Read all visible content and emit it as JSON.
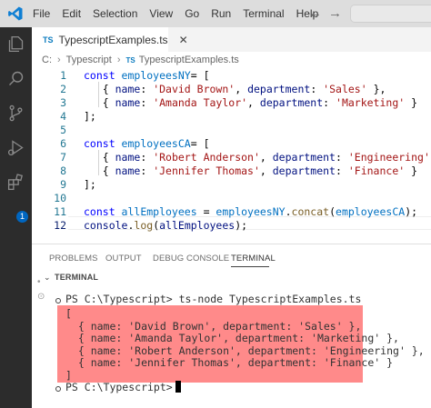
{
  "menu": [
    "File",
    "Edit",
    "Selection",
    "View",
    "Go",
    "Run",
    "Terminal",
    "Help"
  ],
  "editor": {
    "tab_badge": "TS",
    "tab_label": "TypescriptExamples.ts",
    "breadcrumb": [
      "C:",
      "Typescript",
      "TypescriptExamples.ts"
    ],
    "active_line": 12,
    "lines": [
      {
        "n": "1",
        "tokens": [
          [
            "k",
            "const "
          ],
          [
            "c",
            "employeesNY"
          ],
          [
            "",
            "= ["
          ]
        ]
      },
      {
        "n": "2",
        "tokens": [
          [
            "",
            "   { "
          ],
          [
            "v",
            "name"
          ],
          [
            "",
            ": "
          ],
          [
            "s",
            "'David Brown'"
          ],
          [
            "",
            ", "
          ],
          [
            "v",
            "department"
          ],
          [
            "",
            ": "
          ],
          [
            "s",
            "'Sales'"
          ],
          [
            "",
            " },"
          ]
        ]
      },
      {
        "n": "3",
        "tokens": [
          [
            "",
            "   { "
          ],
          [
            "v",
            "name"
          ],
          [
            "",
            ": "
          ],
          [
            "s",
            "'Amanda Taylor'"
          ],
          [
            "",
            ", "
          ],
          [
            "v",
            "department"
          ],
          [
            "",
            ": "
          ],
          [
            "s",
            "'Marketing'"
          ],
          [
            "",
            " }"
          ]
        ]
      },
      {
        "n": "4",
        "tokens": [
          [
            "",
            "];"
          ]
        ]
      },
      {
        "n": "5",
        "tokens": []
      },
      {
        "n": "6",
        "tokens": [
          [
            "k",
            "const "
          ],
          [
            "c",
            "employeesCA"
          ],
          [
            "",
            "= ["
          ]
        ]
      },
      {
        "n": "7",
        "tokens": [
          [
            "",
            "   { "
          ],
          [
            "v",
            "name"
          ],
          [
            "",
            ": "
          ],
          [
            "s",
            "'Robert Anderson'"
          ],
          [
            "",
            ", "
          ],
          [
            "v",
            "department"
          ],
          [
            "",
            ": "
          ],
          [
            "s",
            "'Engineering'"
          ],
          [
            "",
            " },"
          ]
        ]
      },
      {
        "n": "8",
        "tokens": [
          [
            "",
            "   { "
          ],
          [
            "v",
            "name"
          ],
          [
            "",
            ": "
          ],
          [
            "s",
            "'Jennifer Thomas'"
          ],
          [
            "",
            ", "
          ],
          [
            "v",
            "department"
          ],
          [
            "",
            ": "
          ],
          [
            "s",
            "'Finance'"
          ],
          [
            "",
            " }"
          ]
        ]
      },
      {
        "n": "9",
        "tokens": [
          [
            "",
            "];"
          ]
        ]
      },
      {
        "n": "10",
        "tokens": []
      },
      {
        "n": "11",
        "tokens": [
          [
            "k",
            "const "
          ],
          [
            "c",
            "allEmployees"
          ],
          [
            "",
            " = "
          ],
          [
            "c",
            "employeesNY"
          ],
          [
            "",
            "."
          ],
          [
            "f",
            "concat"
          ],
          [
            "",
            "("
          ],
          [
            "c",
            "employeesCA"
          ],
          [
            "",
            ");"
          ]
        ]
      },
      {
        "n": "12",
        "tokens": [
          [
            "v",
            "console"
          ],
          [
            "",
            "."
          ],
          [
            "f",
            "log"
          ],
          [
            "",
            "("
          ],
          [
            "v",
            "allEmployees"
          ],
          [
            "",
            ");"
          ]
        ]
      }
    ]
  },
  "panel": {
    "tabs": [
      "PROBLEMS",
      "OUTPUT",
      "DEBUG CONSOLE",
      "TERMINAL"
    ],
    "active_tab": "TERMINAL",
    "section_title": "TERMINAL",
    "command_line": "PS C:\\Typescript> ts-node TypescriptExamples.ts",
    "output": [
      "[",
      "  { name: 'David Brown', department: 'Sales' },",
      "  { name: 'Amanda Taylor', department: 'Marketing' },",
      "  { name: 'Robert Anderson', department: 'Engineering' },",
      "  { name: 'Jennifer Thomas', department: 'Finance' }",
      "]"
    ],
    "final_prompt": "PS C:\\Typescript>"
  },
  "activity_badge": "1",
  "colors": {
    "highlight": "#ff8a8a",
    "activity_bar": "#2c2c2c",
    "title_bar": "#dddddd"
  }
}
